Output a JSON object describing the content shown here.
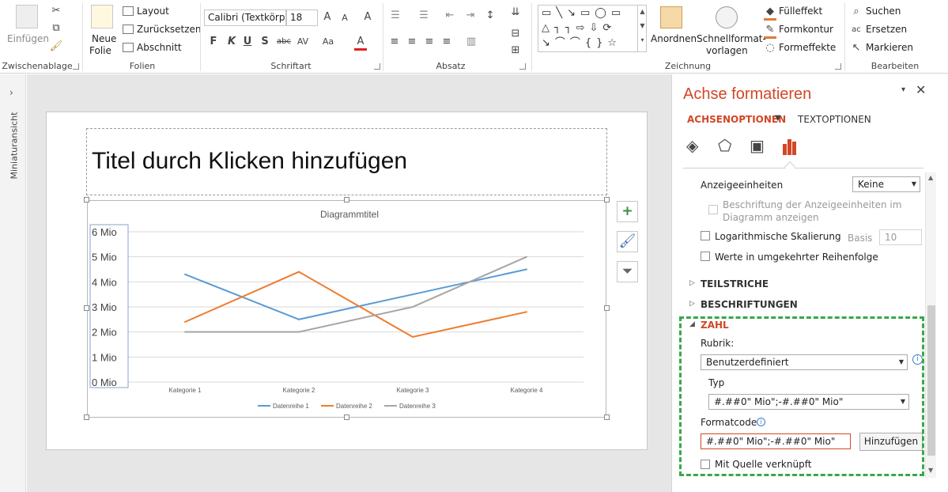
{
  "ribbon": {
    "clipboard": {
      "paste_label": "Einfügen",
      "group_label": "Zwischenablage"
    },
    "slides": {
      "new_slide_label_1": "Neue",
      "new_slide_label_2": "Folie",
      "layout_label": "Layout",
      "reset_label": "Zurücksetzen",
      "section_label": "Abschnitt",
      "group_label": "Folien"
    },
    "font": {
      "font_name": "Calibri (Textkörp",
      "font_size": "18",
      "group_label": "Schriftart"
    },
    "paragraph": {
      "group_label": "Absatz"
    },
    "drawing": {
      "arrange_label": "Anordnen",
      "quickstyles_label_1": "Schnellformat-",
      "quickstyles_label_2": "vorlagen",
      "fill_label": "Fülleffekt",
      "outline_label": "Formkontur",
      "effects_label": "Formeffekte",
      "group_label": "Zeichnung"
    },
    "editing": {
      "find_label": "Suchen",
      "replace_label": "Ersetzen",
      "select_label": "Markieren",
      "group_label": "Bearbeiten"
    }
  },
  "left_strip": {
    "label": "Miniaturansicht"
  },
  "slide": {
    "title_placeholder": "Titel durch Klicken hinzufügen"
  },
  "chart_data": {
    "type": "line",
    "title": "Diagrammtitel",
    "categories": [
      "Kategorie 1",
      "Kategorie 2",
      "Kategorie 3",
      "Kategorie 4"
    ],
    "ylim": [
      0,
      6
    ],
    "yticks": [
      "0 Mio",
      "1 Mio",
      "2 Mio",
      "3 Mio",
      "4 Mio",
      "5 Mio",
      "6 Mio"
    ],
    "grid": true,
    "legend_position": "bottom",
    "series": [
      {
        "name": "Datenreihe 1",
        "values": [
          4.3,
          2.5,
          3.5,
          4.5
        ],
        "color": "#5b9bd5"
      },
      {
        "name": "Datenreihe 2",
        "values": [
          2.4,
          4.4,
          1.8,
          2.8
        ],
        "color": "#ed7d31"
      },
      {
        "name": "Datenreihe 3",
        "values": [
          2.0,
          2.0,
          3.0,
          5.0
        ],
        "color": "#a5a5a5"
      }
    ]
  },
  "pane": {
    "title": "Achse formatieren",
    "tab_axis": "ACHSENOPTIONEN",
    "tab_text": "TEXTOPTIONEN",
    "display_units_label": "Anzeigeeinheiten",
    "display_units_value": "Keine",
    "show_units_label_1": "Beschriftung der Anzeigeeinheiten im",
    "show_units_label_2": "Diagramm anzeigen",
    "log_scale_label": "Logarithmische Skalierung",
    "base_label": "Basis",
    "base_value": "10",
    "reverse_label": "Werte in umgekehrter Reihenfolge",
    "section_ticks": "TEILSTRICHE",
    "section_labels": "BESCHRIFTUNGEN",
    "section_number": "ZAHL",
    "category_label": "Rubrik:",
    "category_value": "Benutzerdefiniert",
    "type_label": "Typ",
    "type_value": "#.##0\" Mio\";-#.##0\" Mio\"",
    "format_code_label": "Formatcode",
    "format_code_value": "#.##0\" Mio\";-#.##0\" Mio\"",
    "add_button": "Hinzufügen",
    "linked_label": "Mit Quelle verknüpft",
    "accent_color": "#d24726"
  }
}
